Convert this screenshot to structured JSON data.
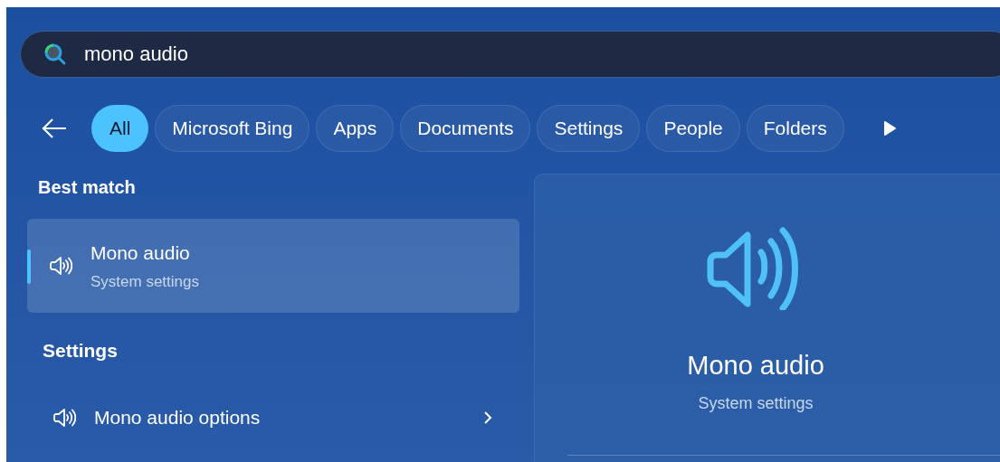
{
  "search": {
    "value": "mono audio"
  },
  "filters": [
    {
      "label": "All",
      "selected": true
    },
    {
      "label": "Microsoft Bing",
      "selected": false
    },
    {
      "label": "Apps",
      "selected": false
    },
    {
      "label": "Documents",
      "selected": false
    },
    {
      "label": "Settings",
      "selected": false
    },
    {
      "label": "People",
      "selected": false
    },
    {
      "label": "Folders",
      "selected": false
    }
  ],
  "best_match": {
    "heading": "Best match",
    "items": [
      {
        "title": "Mono audio",
        "subtitle": "System settings",
        "selected": true
      }
    ]
  },
  "settings": {
    "heading": "Settings",
    "items": [
      {
        "label": "Mono audio options"
      }
    ]
  },
  "preview": {
    "title": "Mono audio",
    "subtitle": "System settings"
  }
}
